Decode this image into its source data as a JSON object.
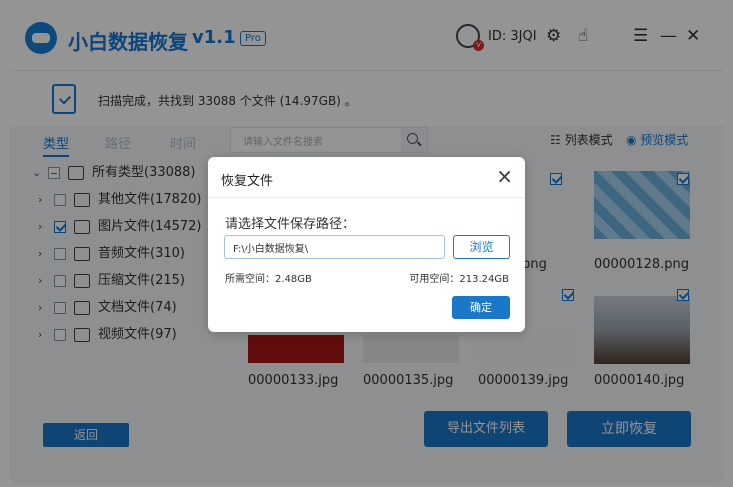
{
  "app": {
    "title": "小白数据恢复",
    "version": "v1.1",
    "badge": "Pro",
    "user_id": "ID: 3JQI"
  },
  "scan": {
    "status": "扫描完成，共找到 33088 个文件 (14.97GB) 。"
  },
  "tabs": [
    {
      "label": "类型"
    },
    {
      "label": "路径"
    },
    {
      "label": "时间"
    }
  ],
  "tree": [
    {
      "label": "所有类型(33088)"
    },
    {
      "label": "其他文件(17820)"
    },
    {
      "label": "图片文件(14572)"
    },
    {
      "label": "音频文件(310)"
    },
    {
      "label": "压缩文件(215)"
    },
    {
      "label": "文档文件(74)"
    },
    {
      "label": "视频文件(97)"
    }
  ],
  "search": {
    "placeholder": "请输入文件名搜索"
  },
  "view": {
    "list_label": "列表模式",
    "preview_label": "预览模式"
  },
  "files": [
    {
      "name": ".png"
    },
    {
      "name": "00000128.png"
    },
    {
      "name": "00000133.jpg"
    },
    {
      "name": "00000135.jpg"
    },
    {
      "name": "00000139.jpg"
    },
    {
      "name": "00000140.jpg"
    }
  ],
  "buttons": {
    "back": "返回",
    "export": "导出文件列表",
    "recover": "立即恢复"
  },
  "dialog": {
    "title": "恢复文件",
    "prompt": "请选择文件保存路径：",
    "path": "F:\\小白数据恢复\\",
    "browse": "浏览",
    "required_space": "所需空间：2.48GB",
    "available_space": "可用空间：213.24GB",
    "ok": "确定"
  },
  "icons": {
    "close": "close-icon",
    "robot": "robot-icon",
    "hand": "hand-icon",
    "menu": "menu-icon",
    "minimize": "minimize-icon"
  },
  "colors": {
    "accent": "#1777d3",
    "button": "#1b77c8"
  }
}
